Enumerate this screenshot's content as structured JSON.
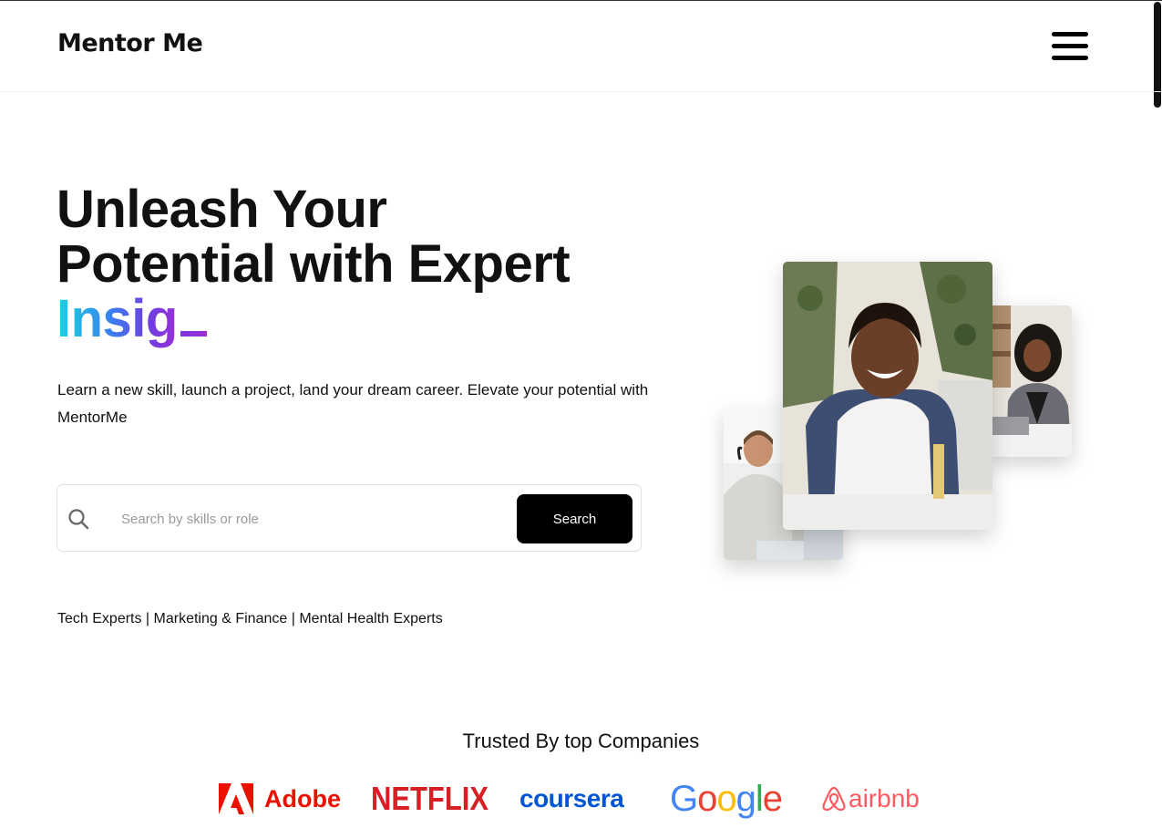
{
  "header": {
    "logo": "Mentor Me",
    "menu_icon": "hamburger-menu-icon"
  },
  "hero": {
    "title_line1": "Unleash Your",
    "title_line2": "Potential with Expert",
    "typed_word": "Insig",
    "subtitle": "Learn a new skill, launch a project, land your dream career. Elevate your potential with MentorMe",
    "search": {
      "icon": "search-icon",
      "placeholder": "Search by skills or role",
      "value": "",
      "button_label": "Search"
    },
    "categories": "Tech Experts | Marketing & Finance | Mental Health Experts"
  },
  "trusted": {
    "heading": "Trusted By top Companies",
    "brands": [
      "Adobe",
      "NETFLIX",
      "coursera",
      "Google",
      "airbnb"
    ]
  },
  "colors": {
    "accent_gradient_start": "#14d8e0",
    "accent_gradient_end": "#9a2fd8",
    "button_bg": "#000000",
    "adobe": "#eb1000",
    "netflix": "#d81f26",
    "coursera": "#0056d2",
    "airbnb": "#ff5a5f"
  }
}
